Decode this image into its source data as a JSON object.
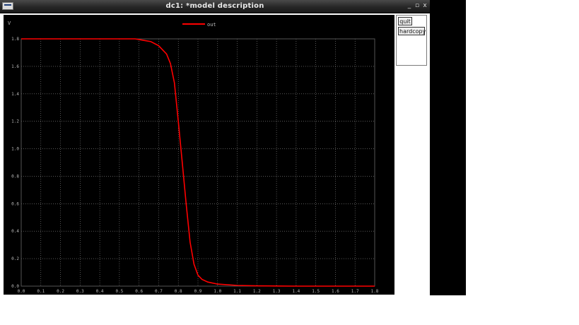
{
  "window": {
    "title": "dc1: *model description",
    "controls": {
      "minimize": "_",
      "maximize": "▫",
      "close": "x"
    }
  },
  "side_buttons": {
    "quit": "quit",
    "hardcopy": "hardcopy"
  },
  "chart_data": {
    "type": "line",
    "ylabel": "V",
    "x_ticks": [
      "0.0",
      "0.1",
      "0.2",
      "0.3",
      "0.4",
      "0.5",
      "0.6",
      "0.7",
      "0.8",
      "0.9",
      "1.0",
      "1.1",
      "1.2",
      "1.3",
      "1.4",
      "1.5",
      "1.6",
      "1.7",
      "1.8"
    ],
    "y_ticks": [
      "0.0",
      "0.2",
      "0.4",
      "0.6",
      "0.8",
      "1.0",
      "1.2",
      "1.4",
      "1.6",
      "1.8"
    ],
    "xlim": [
      0,
      1.8
    ],
    "ylim": [
      0,
      1.8
    ],
    "grid": true,
    "legend": "top-center",
    "series": [
      {
        "name": "out",
        "color": "#ff0000",
        "x": [
          0,
          0.2,
          0.4,
          0.5,
          0.58,
          0.62,
          0.66,
          0.7,
          0.74,
          0.76,
          0.78,
          0.8,
          0.82,
          0.84,
          0.86,
          0.88,
          0.9,
          0.92,
          0.95,
          1.0,
          1.1,
          1.2,
          1.3,
          1.4,
          1.5,
          1.6,
          1.7,
          1.8
        ],
        "y": [
          1.8,
          1.8,
          1.8,
          1.8,
          1.8,
          1.79,
          1.78,
          1.75,
          1.69,
          1.62,
          1.48,
          1.2,
          0.9,
          0.6,
          0.32,
          0.16,
          0.08,
          0.05,
          0.03,
          0.015,
          0.005,
          0.002,
          0.001,
          0.0,
          0.0,
          0.0,
          0.0,
          0.0
        ]
      }
    ]
  }
}
